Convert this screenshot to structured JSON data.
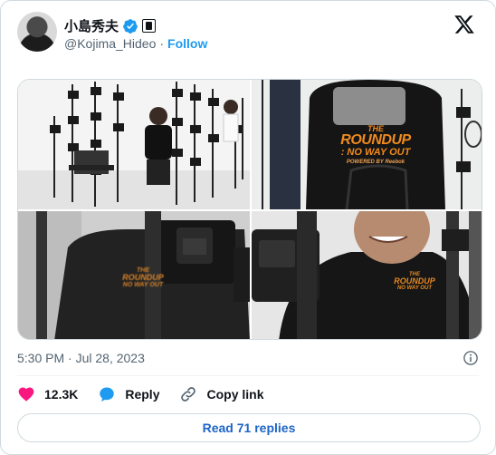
{
  "author": {
    "display_name": "小島秀夫",
    "handle": "@Kojima_Hideo",
    "follow_label": "Follow",
    "verified_icon": "verified-badge-icon",
    "affiliate_icon": "affiliate-badge-icon"
  },
  "platform_icon": "x-logo-icon",
  "media": {
    "photos": [
      {
        "name": "photo-scanning-rig-wide",
        "overlay_text": []
      },
      {
        "name": "photo-back-shirt",
        "overlay_text": [
          "THE",
          "ROUNDUP",
          ": NO WAY OUT",
          "POWERED BY Reebok"
        ]
      },
      {
        "name": "photo-camera-closeup",
        "overlay_text": [
          "THE",
          "ROUNDUP",
          "NO WAY OUT"
        ]
      },
      {
        "name": "photo-smiling-man",
        "overlay_text": [
          "THE",
          "ROUNDUP",
          "NO WAY OUT"
        ]
      }
    ]
  },
  "timestamp": "5:30 PM · Jul 28, 2023",
  "actions": {
    "likes_count": "12.3K",
    "reply_label": "Reply",
    "copy_link_label": "Copy link"
  },
  "read_replies_label": "Read 71 replies",
  "colors": {
    "accent": "#1d9bf0",
    "like": "#f91880",
    "text_primary": "#0f1419",
    "text_secondary": "#536471",
    "border": "#cfd9de"
  }
}
